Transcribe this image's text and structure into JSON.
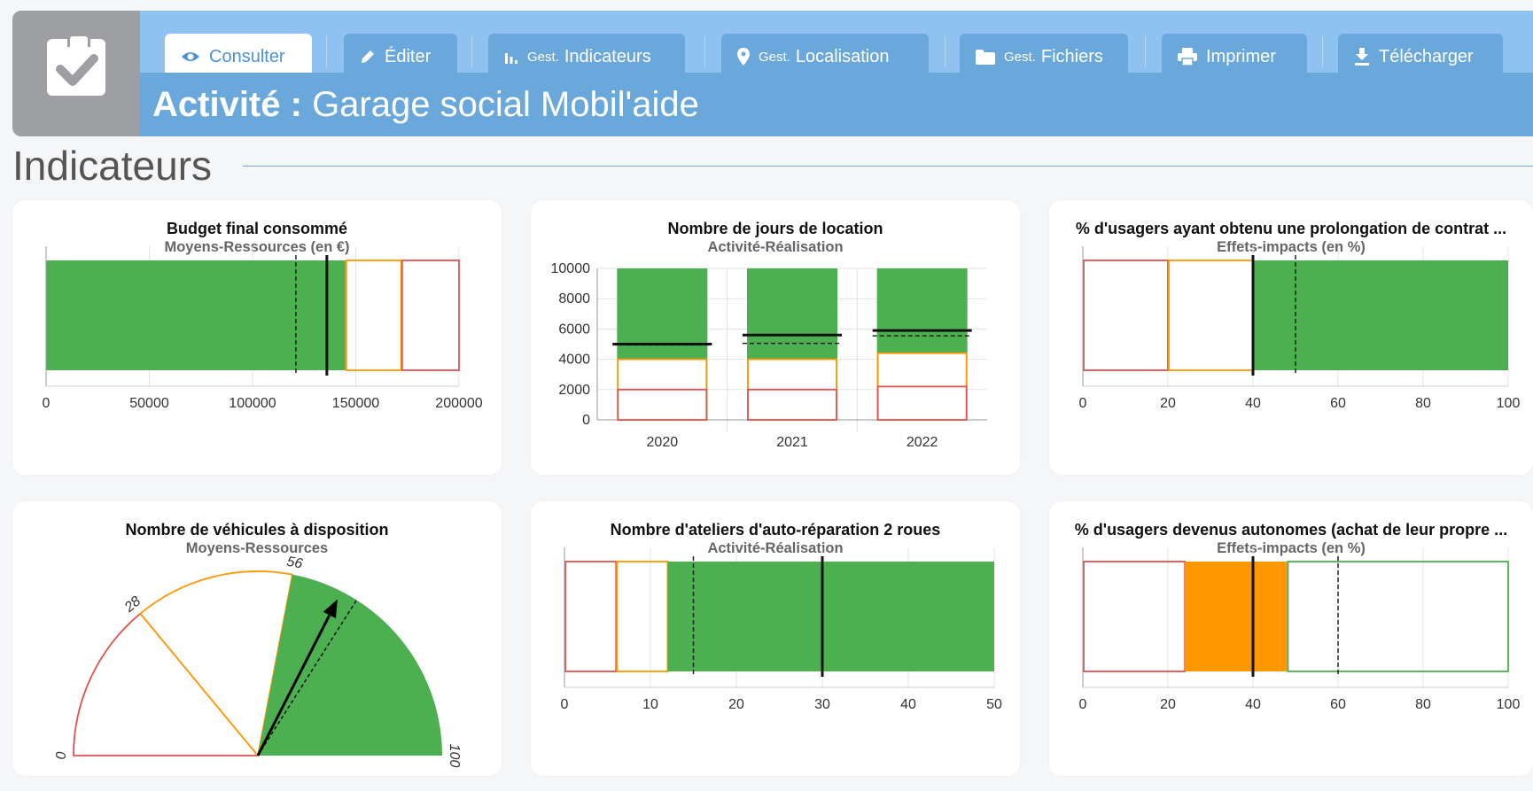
{
  "toolbar": {
    "buttons": [
      {
        "label": "Consulter",
        "prefix": "",
        "icon": "eye-icon"
      },
      {
        "label": "Éditer",
        "prefix": "",
        "icon": "pencil-icon"
      },
      {
        "label": "Indicateurs",
        "prefix": "Gest.",
        "icon": "bar-chart-icon"
      },
      {
        "label": "Localisation",
        "prefix": "Gest.",
        "icon": "map-pin-icon"
      },
      {
        "label": "Fichiers",
        "prefix": "Gest.",
        "icon": "folder-icon"
      },
      {
        "label": "Imprimer",
        "prefix": "",
        "icon": "printer-icon"
      },
      {
        "label": "Télécharger",
        "prefix": "",
        "icon": "download-icon"
      }
    ]
  },
  "header": {
    "label": "Activité :",
    "name": "Garage social Mobil'aide",
    "badge_icon": "clipboard-check-icon"
  },
  "section": {
    "title": "Indicateurs"
  },
  "colors": {
    "green": "#4caf50",
    "orange": "#ff9800",
    "red": "#e05252",
    "header_light": "#8fc2f0",
    "header_dark": "#6aa8dc"
  },
  "cards": [
    {
      "title": "Budget final consommé",
      "subtitle": "Moyens-Ressources (en €)"
    },
    {
      "title": "Nombre de jours de location",
      "subtitle": "Activité-Réalisation"
    },
    {
      "title": "% d'usagers ayant obtenu une prolongation de contrat ...",
      "subtitle": "Effets-impacts (en %)"
    },
    {
      "title": "Nombre de véhicules à disposition",
      "subtitle": "Moyens-Ressources"
    },
    {
      "title": "Nombre d'ateliers d'auto-réparation 2 roues",
      "subtitle": "Activité-Réalisation"
    },
    {
      "title": "% d'usagers devenus autonomes (achat de leur propre ...",
      "subtitle": "Effets-impacts (en %)"
    }
  ],
  "chart_data": [
    {
      "type": "bullet",
      "title": "Budget final consommé",
      "subtitle": "Moyens-Ressources (en €)",
      "xlim": [
        0,
        200000
      ],
      "ticks": [
        0,
        50000,
        100000,
        150000,
        200000
      ],
      "value": 145000,
      "target": 136000,
      "dashed_target": 121000,
      "bands": [
        {
          "to": 145000,
          "color": "green",
          "fill": true
        },
        {
          "to": 172000,
          "color": "orange",
          "fill": false
        },
        {
          "to": 200000,
          "color": "red",
          "fill": false
        }
      ]
    },
    {
      "type": "bar",
      "title": "Nombre de jours de location",
      "subtitle": "Activité-Réalisation",
      "categories": [
        "2020",
        "2021",
        "2022"
      ],
      "ylim": [
        0,
        10000
      ],
      "yticks": [
        0,
        2000,
        4000,
        6000,
        8000,
        10000
      ],
      "series": [
        {
          "values": [
            10000,
            10000,
            10000
          ],
          "color": "green"
        },
        {
          "values": [
            4000,
            4000,
            4400
          ],
          "color": "orange"
        },
        {
          "values": [
            2000,
            2000,
            2200
          ],
          "color": "red"
        }
      ],
      "targets": [
        5000,
        5600,
        5900
      ],
      "dashed_targets": [
        4950,
        5050,
        5550
      ]
    },
    {
      "type": "bullet",
      "title": "% d'usagers ayant obtenu une prolongation de contrat ...",
      "subtitle": "Effets-impacts (en %)",
      "xlim": [
        0,
        100
      ],
      "ticks": [
        0,
        20,
        40,
        60,
        80,
        100
      ],
      "value": 40,
      "target": 40,
      "dashed_target": 50,
      "bands": [
        {
          "from": 0,
          "to": 20,
          "color": "red",
          "fill": false
        },
        {
          "from": 20,
          "to": 40,
          "color": "orange",
          "fill": false
        },
        {
          "from": 40,
          "to": 100,
          "color": "green",
          "fill": true
        }
      ]
    },
    {
      "type": "gauge",
      "title": "Nombre de véhicules à disposition",
      "subtitle": "Moyens-Ressources",
      "min": 0,
      "max": 100,
      "labels": [
        "0",
        "28",
        "56",
        "100"
      ],
      "bands": [
        {
          "from": 0,
          "to": 28,
          "color": "red",
          "fill": false
        },
        {
          "from": 28,
          "to": 56,
          "color": "orange",
          "fill": false
        },
        {
          "from": 56,
          "to": 100,
          "color": "green",
          "fill": true
        }
      ],
      "value": 65,
      "dashed_target": 68
    },
    {
      "type": "bullet",
      "title": "Nombre d'ateliers d'auto-réparation 2 roues",
      "subtitle": "Activité-Réalisation",
      "xlim": [
        0,
        50
      ],
      "ticks": [
        0,
        10,
        20,
        30,
        40,
        50
      ],
      "value": 30,
      "target": 30,
      "dashed_target": 15,
      "bands": [
        {
          "from": 0,
          "to": 6,
          "color": "red",
          "fill": false
        },
        {
          "from": 6,
          "to": 12,
          "color": "orange",
          "fill": false
        },
        {
          "from": 12,
          "to": 50,
          "color": "green",
          "fill": true
        }
      ]
    },
    {
      "type": "bullet",
      "title": "% d'usagers devenus autonomes (achat de leur propre ...",
      "subtitle": "Effets-impacts (en %)",
      "xlim": [
        0,
        100
      ],
      "ticks": [
        0,
        20,
        40,
        60,
        80,
        100
      ],
      "value": 40,
      "target": 40,
      "dashed_target": 60,
      "bands": [
        {
          "from": 0,
          "to": 24,
          "color": "red",
          "fill": false
        },
        {
          "from": 24,
          "to": 48,
          "color": "orange",
          "fill": true
        },
        {
          "from": 48,
          "to": 100,
          "color": "green",
          "fill": false
        }
      ]
    }
  ]
}
